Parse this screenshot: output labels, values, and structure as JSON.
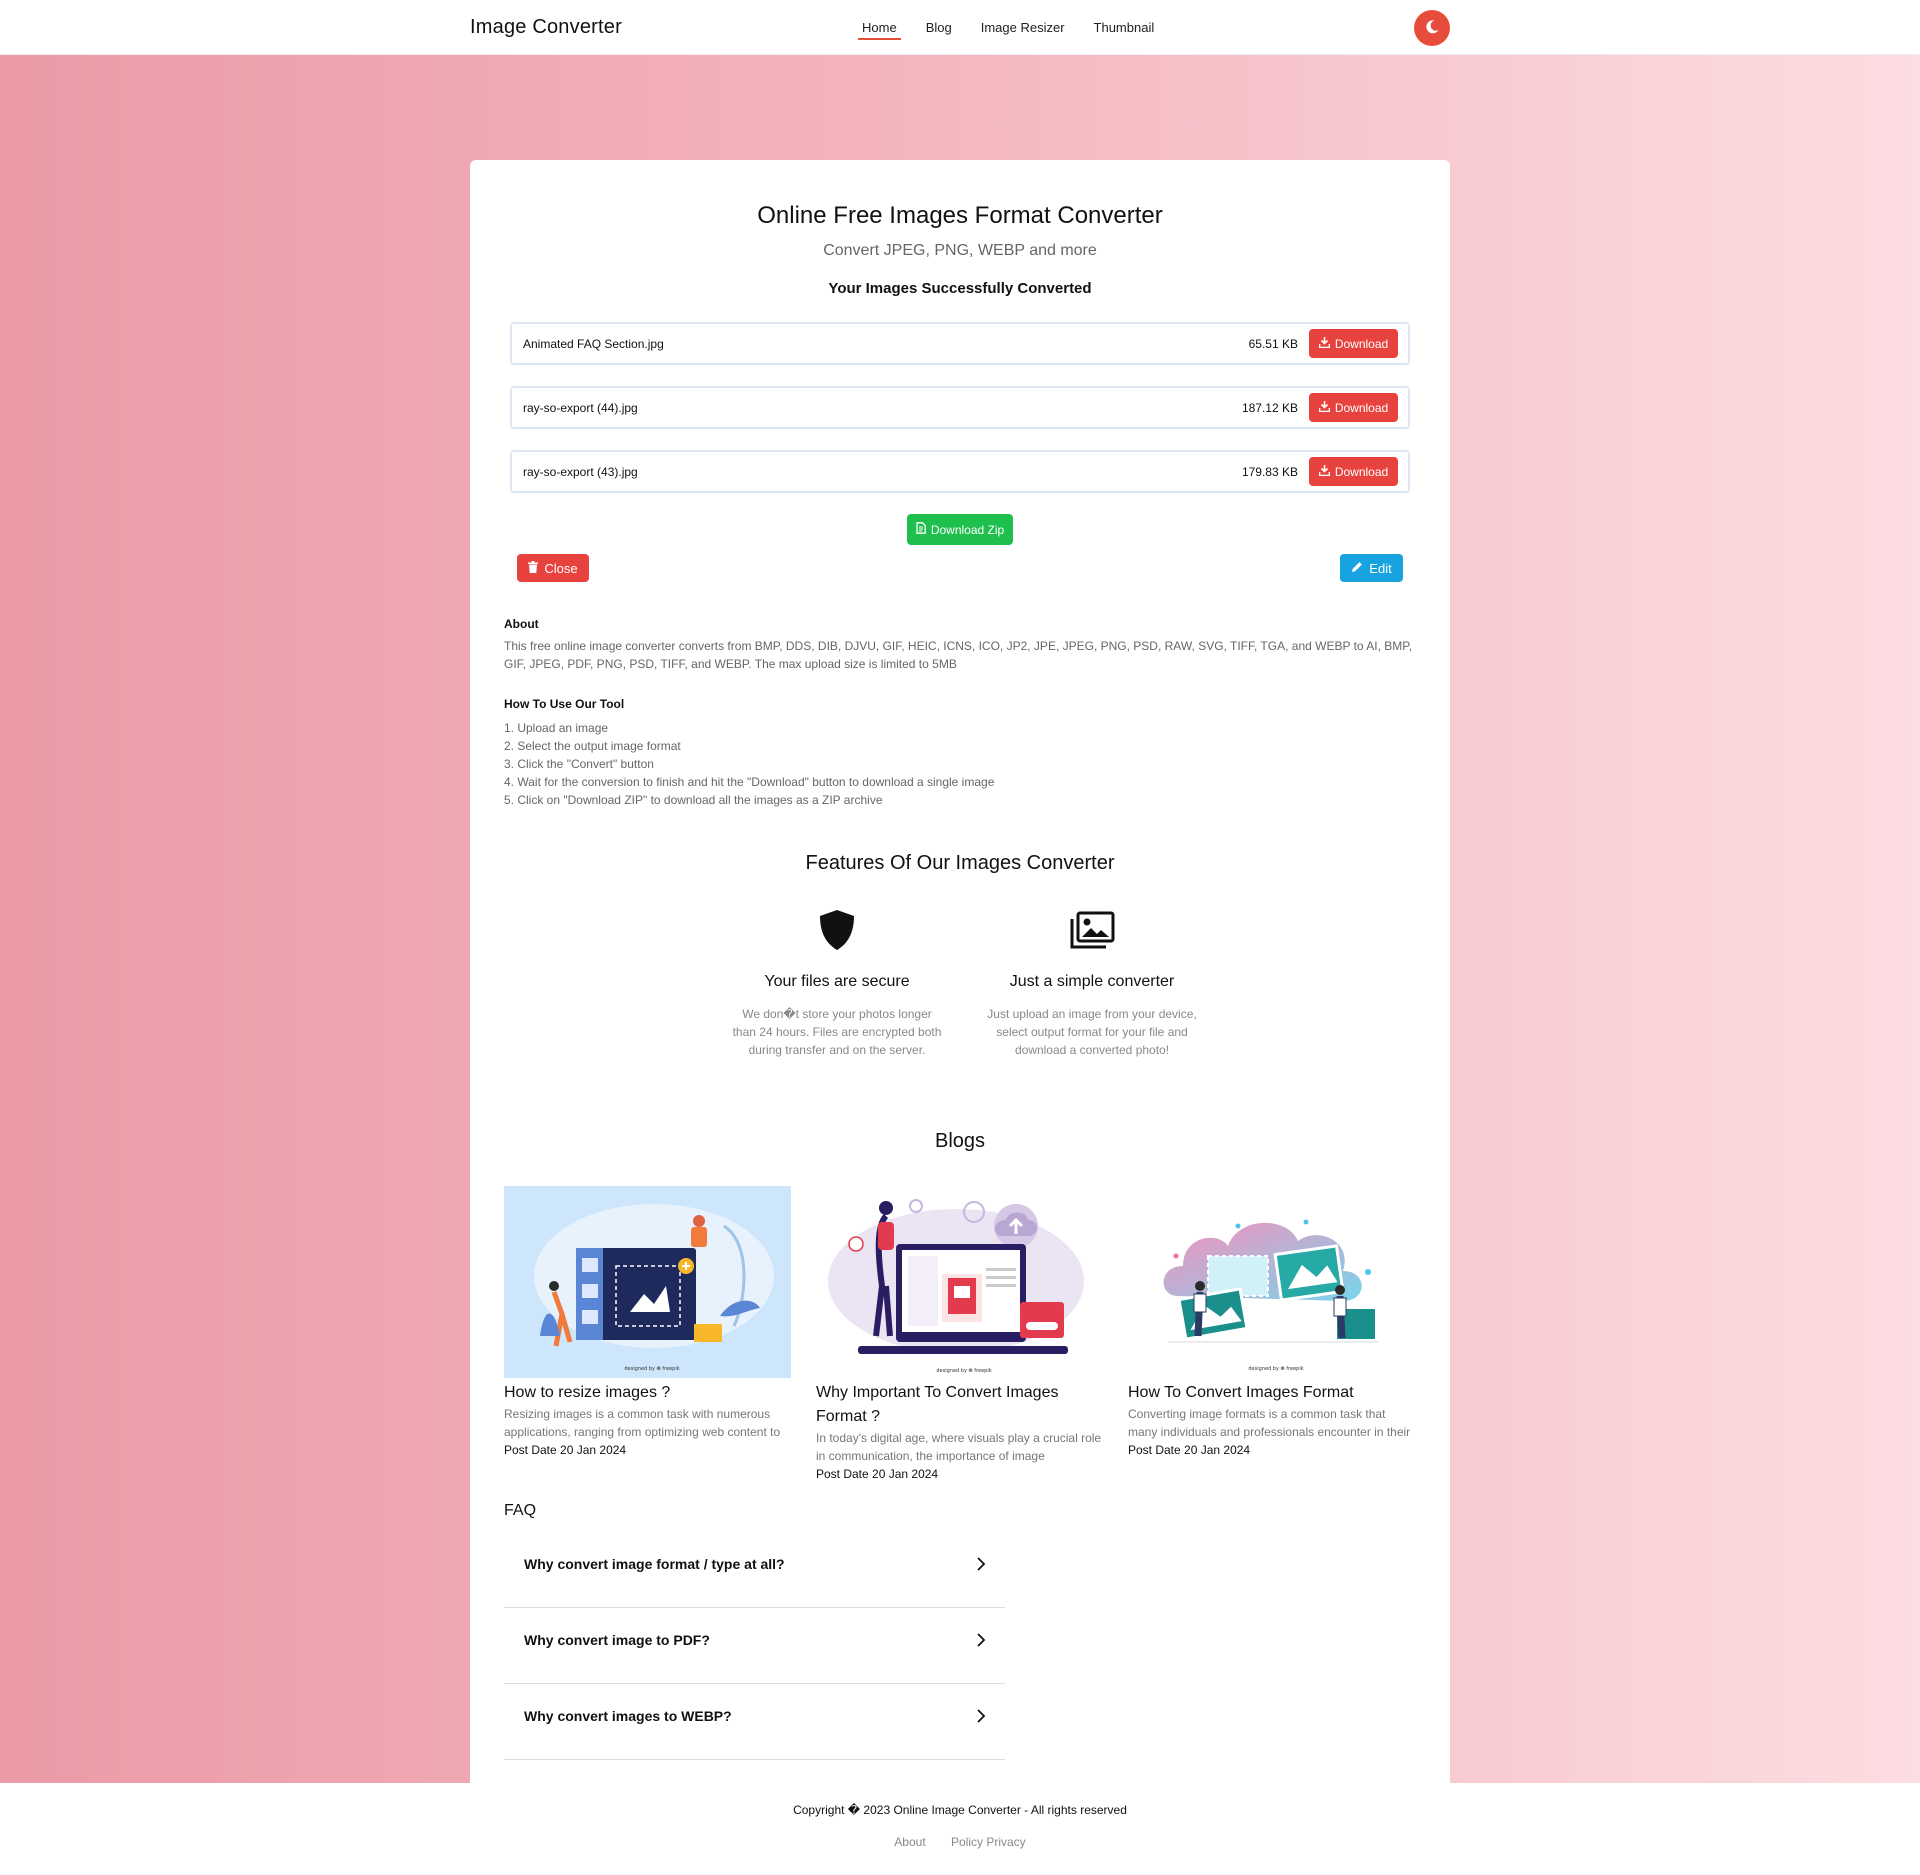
{
  "header": {
    "brand": "Image Converter",
    "nav": [
      {
        "label": "Home",
        "active": true
      },
      {
        "label": "Blog",
        "active": false
      },
      {
        "label": "Image Resizer",
        "active": false
      },
      {
        "label": "Thumbnail",
        "active": false
      }
    ],
    "theme_icon": "moon-icon"
  },
  "colors": {
    "accent": "#e8423e",
    "zip": "#1fbf4e",
    "edit": "#17a2e0",
    "bg_gradient_start": "#eb9aa6",
    "bg_gradient_end": "#fcdde1"
  },
  "main": {
    "title": "Online Free Images Format Converter",
    "subtitle": "Convert JPEG, PNG, WEBP and more",
    "success": "Your Images Successfully Converted",
    "files": [
      {
        "name": "Animated FAQ Section.jpg",
        "size": "65.51 KB",
        "action": "Download"
      },
      {
        "name": "ray-so-export (44).jpg",
        "size": "187.12 KB",
        "action": "Download"
      },
      {
        "name": "ray-so-export (43).jpg",
        "size": "179.83 KB",
        "action": "Download"
      }
    ],
    "zip_label": "Download Zip",
    "close_label": "Close",
    "edit_label": "Edit"
  },
  "about": {
    "heading": "About",
    "text": "This free online image converter converts from BMP, DDS, DIB, DJVU, GIF, HEIC, ICNS, ICO, JP2, JPE, JPEG, PNG, PSD, RAW, SVG, TIFF, TGA, and WEBP to AI, BMP, GIF, JPEG, PDF, PNG, PSD, TIFF, and WEBP. The max upload size is limited to 5MB"
  },
  "howto": {
    "heading": "How To Use Our Tool",
    "steps": [
      "1. Upload an image",
      "2. Select the output image format",
      "3. Click the \"Convert\" button",
      "4. Wait for the conversion to finish and hit the \"Download\" button to download a single image",
      "5. Click on \"Download ZIP\" to download all the images as a ZIP archive"
    ]
  },
  "features": {
    "heading": "Features Of Our Images Converter",
    "items": [
      {
        "icon": "shield-icon",
        "title": "Your files are secure",
        "desc": "We don�t store your photos longer than 24 hours. Files are encrypted both during transfer and on the server."
      },
      {
        "icon": "images-icon",
        "title": "Just a simple converter",
        "desc": "Just upload an image from your device, select output format for your file and download a converted photo!"
      }
    ]
  },
  "blogs": {
    "heading": "Blogs",
    "items": [
      {
        "title": "How to resize images ?",
        "excerpt": "Resizing images is a common task with numerous applications, ranging from optimizing web content to",
        "date": "Post Date 20 Jan 2024",
        "credit": "designed by ❁ freepik"
      },
      {
        "title": "Why Important To Convert Images Format ?",
        "excerpt": "In today's digital age, where visuals play a crucial role in communication, the importance of image",
        "date": "Post Date 20 Jan 2024",
        "credit": "designed by ❁ freepik"
      },
      {
        "title": "How To Convert Images Format",
        "excerpt": "Converting image formats is a common task that many individuals and professionals encounter in their",
        "date": "Post Date 20 Jan 2024",
        "credit": "designed by ❁ freepik"
      }
    ]
  },
  "faq": {
    "heading": "FAQ",
    "items": [
      {
        "q": "Why convert image format / type at all?"
      },
      {
        "q": "Why convert image to PDF?"
      },
      {
        "q": "Why convert images to WEBP?"
      }
    ]
  },
  "footer": {
    "copyright": "Copyright � 2023 Online Image Converter - All rights reserved",
    "links": [
      "About",
      "Policy Privacy"
    ]
  }
}
